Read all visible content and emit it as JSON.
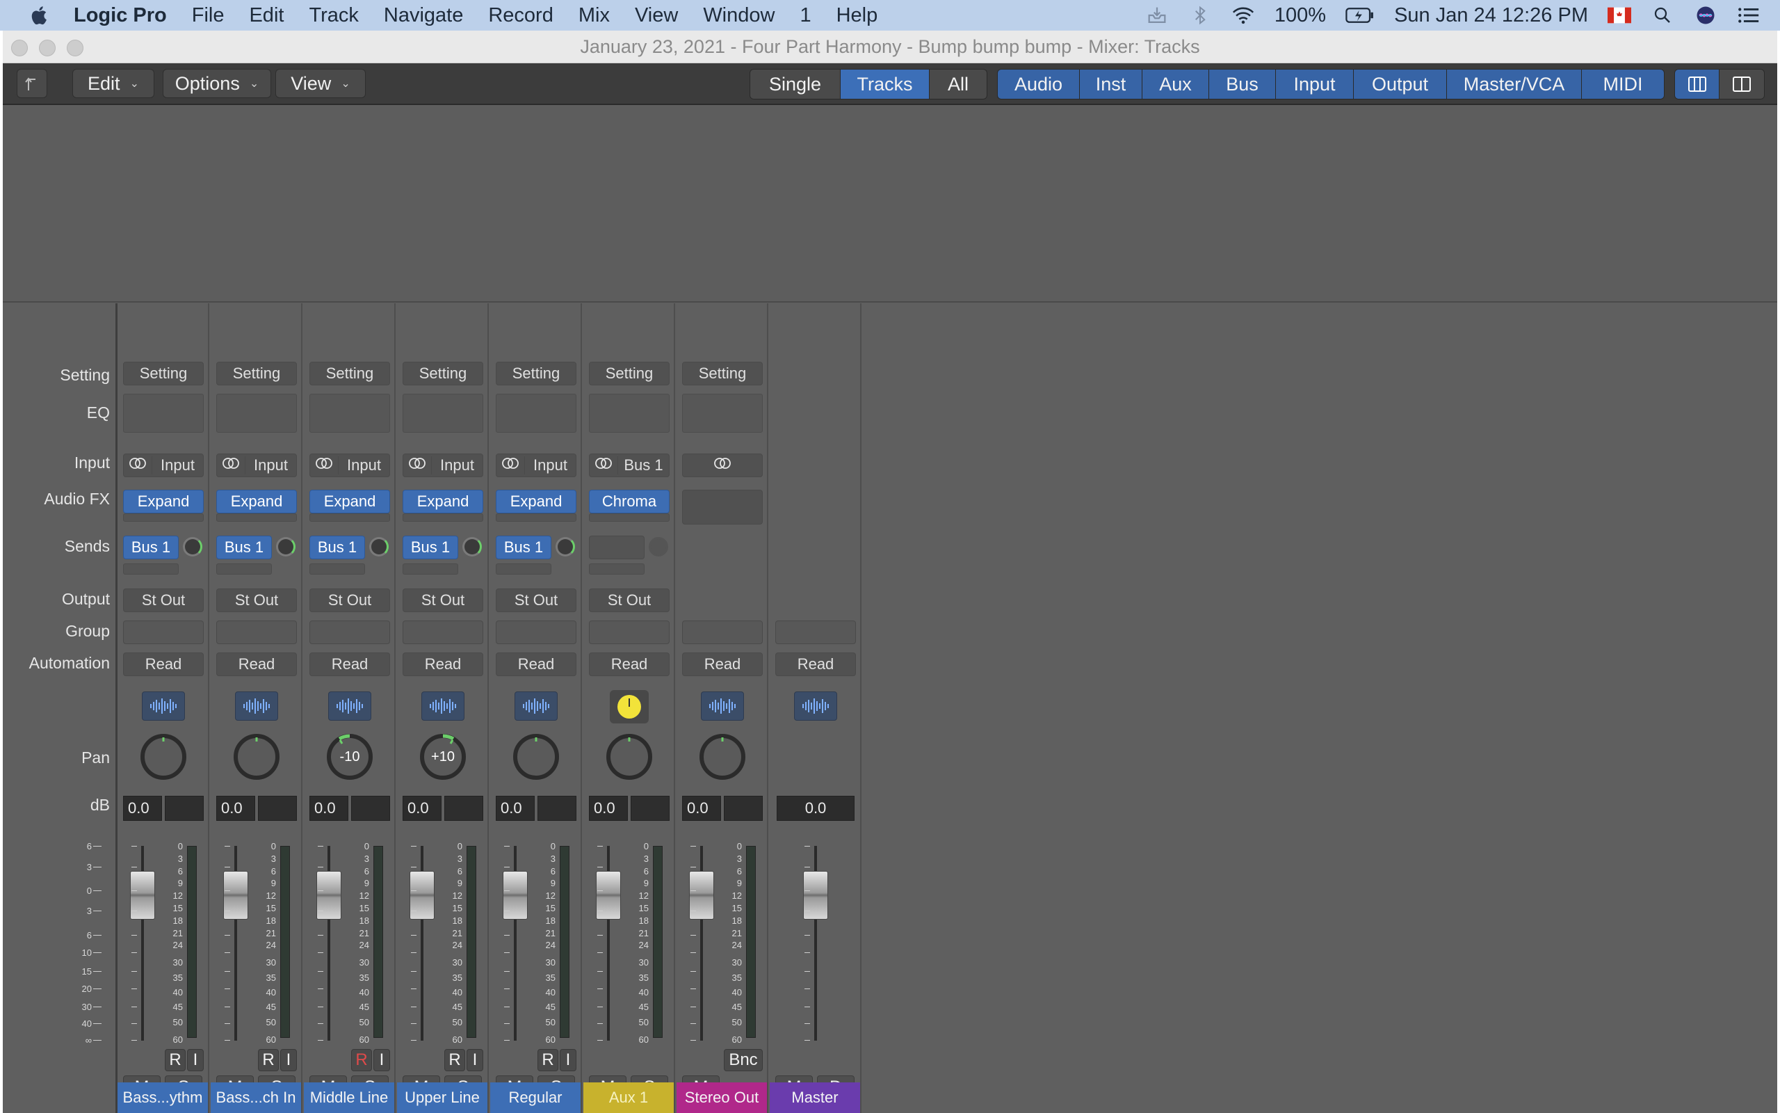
{
  "menubar": {
    "app_name": "Logic Pro",
    "menus": [
      "File",
      "Edit",
      "Track",
      "Navigate",
      "Record",
      "Mix",
      "View",
      "Window",
      "1",
      "Help"
    ],
    "battery": "100%",
    "datetime": "Sun Jan 24  12:26 PM"
  },
  "window": {
    "title": "January 23, 2021 - Four Part Harmony - Bump bump bump - Mixer: Tracks"
  },
  "toolbar": {
    "edit": "Edit",
    "options": "Options",
    "view": "View",
    "view_modes": [
      "Single",
      "Tracks",
      "All"
    ],
    "active_view_mode": "Tracks",
    "filters": [
      "Audio",
      "Inst",
      "Aux",
      "Bus",
      "Input",
      "Output",
      "Master/VCA",
      "MIDI"
    ]
  },
  "row_labels": {
    "setting": "Setting",
    "eq": "EQ",
    "input": "Input",
    "audio_fx": "Audio FX",
    "sends": "Sends",
    "output": "Output",
    "group": "Group",
    "automation": "Automation",
    "pan": "Pan",
    "db": "dB"
  },
  "fader_scale": [
    "6",
    "3",
    "0",
    "3",
    "6",
    "10",
    "15",
    "20",
    "30",
    "40",
    "∞"
  ],
  "meter_scale": [
    "0",
    "3",
    "6",
    "9",
    "12",
    "15",
    "18",
    "21",
    "24",
    "30",
    "35",
    "40",
    "45",
    "50",
    "60"
  ],
  "strips": [
    {
      "name": "Bass...ythm",
      "setting": "Setting",
      "input": "Input",
      "audio_fx": "Expand",
      "send": "Bus 1",
      "output": "St Out",
      "automation": "Read",
      "pan_value": "",
      "db": "0.0",
      "rec": "R",
      "input_mon": "I",
      "mute": "M",
      "solo": "S"
    },
    {
      "name": "Bass...ch In",
      "setting": "Setting",
      "input": "Input",
      "audio_fx": "Expand",
      "send": "Bus 1",
      "output": "St Out",
      "automation": "Read",
      "pan_value": "",
      "db": "0.0",
      "rec": "R",
      "input_mon": "I",
      "mute": "M",
      "solo": "S"
    },
    {
      "name": "Middle Line",
      "setting": "Setting",
      "input": "Input",
      "audio_fx": "Expand",
      "send": "Bus 1",
      "output": "St Out",
      "automation": "Read",
      "pan_value": "-10",
      "db": "0.0",
      "rec": "R",
      "input_mon": "I",
      "mute": "M",
      "solo": "S"
    },
    {
      "name": "Upper Line",
      "setting": "Setting",
      "input": "Input",
      "audio_fx": "Expand",
      "send": "Bus 1",
      "output": "St Out",
      "automation": "Read",
      "pan_value": "+10",
      "db": "0.0",
      "rec": "R",
      "input_mon": "I",
      "mute": "M",
      "solo": "S"
    },
    {
      "name": "Regular",
      "setting": "Setting",
      "input": "Input",
      "audio_fx": "Expand",
      "send": "Bus 1",
      "output": "St Out",
      "automation": "Read",
      "pan_value": "",
      "db": "0.0",
      "rec": "R",
      "input_mon": "I",
      "mute": "M",
      "solo": "S"
    },
    {
      "name": "Aux 1",
      "setting": "Setting",
      "input": "Bus 1",
      "audio_fx": "Chroma",
      "send": "",
      "output": "St Out",
      "automation": "Read",
      "pan_value": "",
      "db": "0.0",
      "mute": "M",
      "solo": "S"
    },
    {
      "name": "Stereo Out",
      "setting": "Setting",
      "input": "",
      "audio_fx": "",
      "send": "",
      "output": "",
      "automation": "Read",
      "pan_value": "",
      "db": "0.0",
      "bounce": "Bnc",
      "mute": "M"
    },
    {
      "name": "Master",
      "automation": "Read",
      "db": "0.0",
      "mute": "M",
      "dim": "D"
    }
  ],
  "colors": {
    "audio": "#3d6eb5",
    "aux": "#c8b22d",
    "stereo_out": "#b0288a",
    "master": "#6a3cad",
    "automation_read": "#69d36d"
  }
}
